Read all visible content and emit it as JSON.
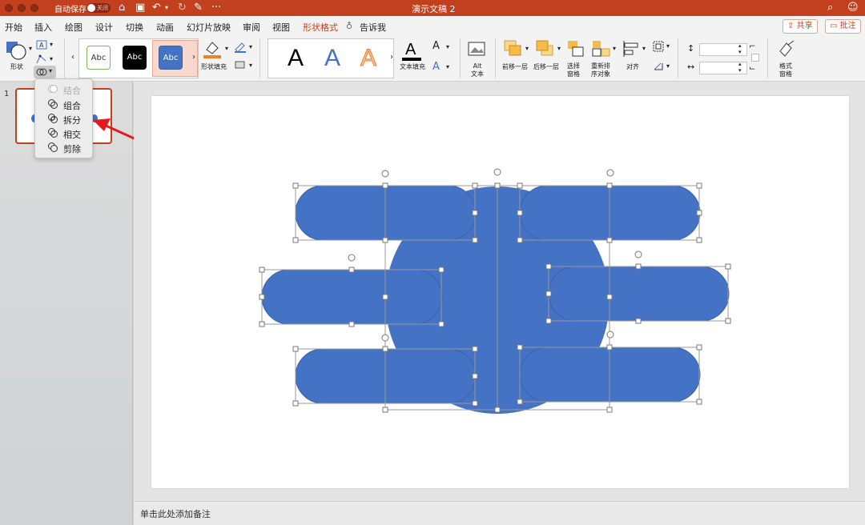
{
  "titlebar": {
    "autosave_label": "自动保存",
    "autosave_state": "关闭",
    "title": "演示文稿 2",
    "more": "···"
  },
  "menu": {
    "tabs": [
      "开始",
      "插入",
      "绘图",
      "设计",
      "切换",
      "动画",
      "幻灯片放映",
      "审阅",
      "视图",
      "形状格式"
    ],
    "active_tab": "形状格式",
    "tell_me": "告诉我",
    "share": "共享",
    "comment": "批注"
  },
  "ribbon": {
    "shape_label": "形状",
    "style_gallery": [
      "Abc",
      "Abc",
      "Abc"
    ],
    "shape_fill_label": "形状填充",
    "wordart": [
      "A",
      "A",
      "A"
    ],
    "text_fill_label": "文本填充",
    "alt_text_label": "Alt\n文本",
    "bring_forward": "前移一层",
    "send_backward": "后移一层",
    "selection_pane": "选择\n窗格",
    "reorder": "重新排\n序对象",
    "align": "对齐",
    "format_pane": "格式\n窗格",
    "accent_color": "#c3401f",
    "fill_color": "#e8832a"
  },
  "merge_menu": {
    "items": [
      {
        "label": "结合",
        "enabled": false
      },
      {
        "label": "组合",
        "enabled": true
      },
      {
        "label": "拆分",
        "enabled": true
      },
      {
        "label": "相交",
        "enabled": true
      },
      {
        "label": "剪除",
        "enabled": true
      }
    ]
  },
  "sidebar": {
    "slide_number": "1"
  },
  "slide": {
    "shape_color": "#4472c4"
  },
  "notes": {
    "placeholder": "单击此处添加备注"
  }
}
